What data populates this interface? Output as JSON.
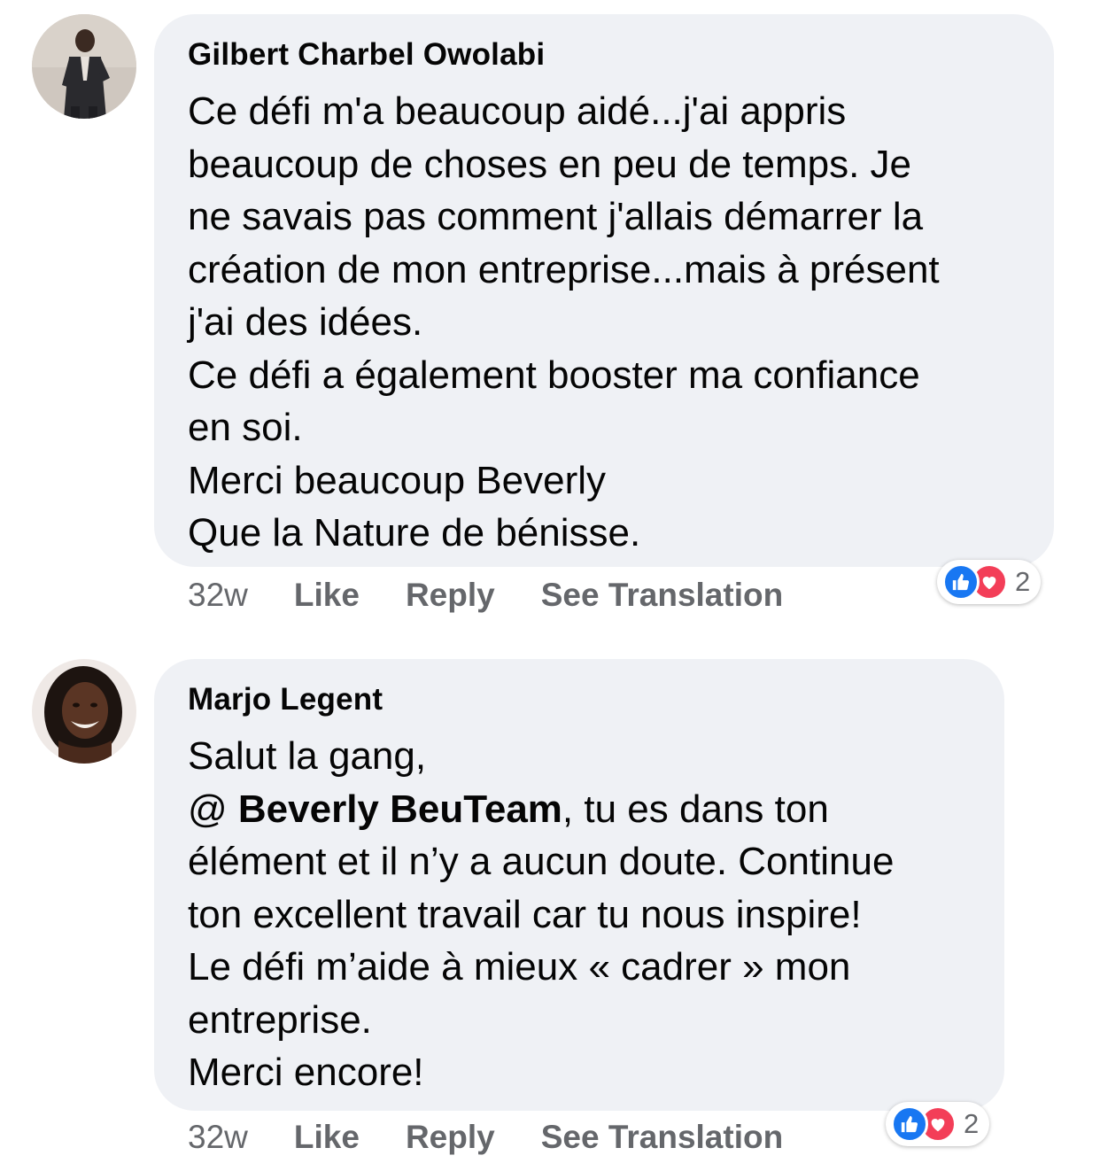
{
  "comments": [
    {
      "author": "Gilbert Charbel Owolabi",
      "lines": [
        "Ce défi m'a beaucoup aidé...j'ai appris",
        "beaucoup de choses en peu de temps. Je",
        "ne savais pas comment j'allais démarrer la",
        "création de mon entreprise...mais à présent",
        "j'ai des idées.",
        "Ce défi a également booster ma confiance",
        "en soi.",
        "Merci beaucoup Beverly",
        "Que la Nature de bénisse."
      ],
      "time": "32w",
      "like_label": "Like",
      "reply_label": "Reply",
      "translate_label": "See Translation",
      "reaction_count": "2",
      "reaction_icons": [
        "like-icon",
        "love-icon"
      ]
    },
    {
      "author": "Marjo Legent",
      "lines": [
        "Salut la gang,",
        "@ ",
        "élément et il n’y a aucun doute. Continue",
        "ton excellent travail car tu nous inspire!",
        "Le défi m’aide à mieux « cadrer » mon",
        "entreprise.",
        "Merci encore!"
      ],
      "mention": "Beverly BeuTeam",
      "mention_suffix": ", tu es dans ton",
      "time": "32w",
      "like_label": "Like",
      "reply_label": "Reply",
      "translate_label": "See Translation",
      "reaction_count": "2",
      "reaction_icons": [
        "like-icon",
        "love-icon"
      ]
    }
  ],
  "colors": {
    "bubble": "#eff1f5",
    "secondary_text": "#65676b",
    "like_blue": "#1877f2",
    "love_red": "#f33e58"
  }
}
